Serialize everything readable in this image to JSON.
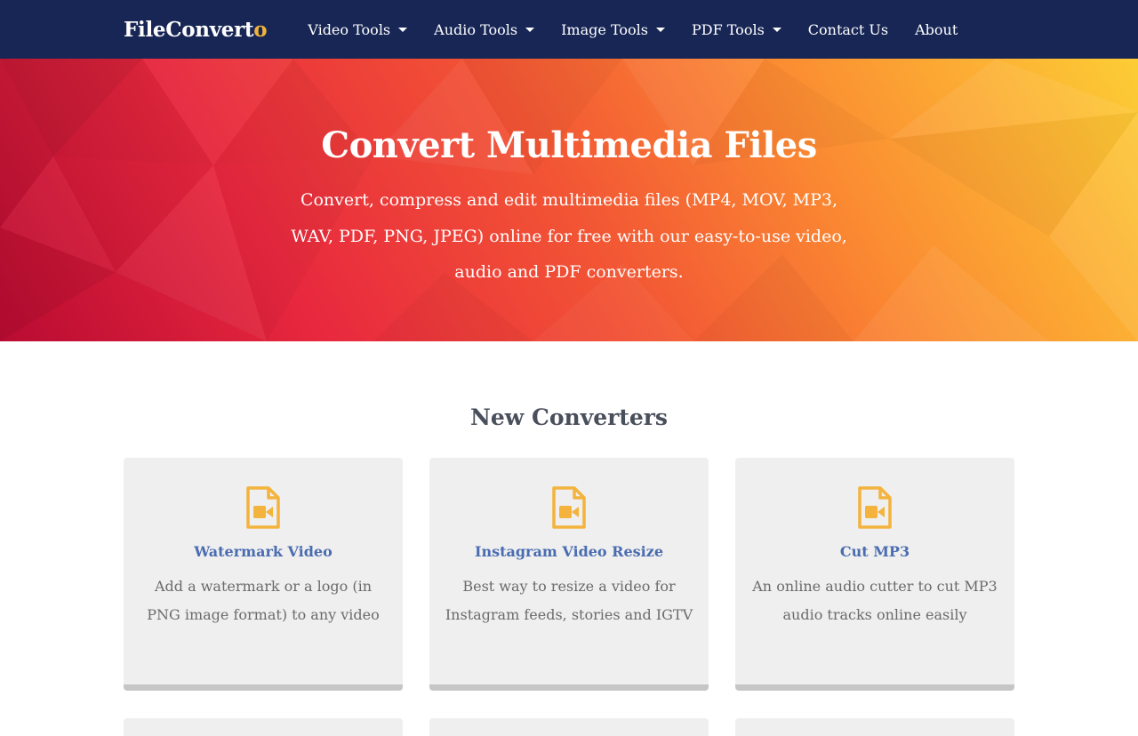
{
  "nav": {
    "brand_main": "FileConvert",
    "brand_accent": "o",
    "items": [
      {
        "label": "Video Tools",
        "dropdown": true
      },
      {
        "label": "Audio Tools",
        "dropdown": true
      },
      {
        "label": "Image Tools",
        "dropdown": true
      },
      {
        "label": "PDF Tools",
        "dropdown": true
      },
      {
        "label": "Contact Us",
        "dropdown": false
      },
      {
        "label": "About",
        "dropdown": false
      }
    ]
  },
  "hero": {
    "title": "Convert Multimedia Files",
    "subtitle": "Convert, compress and edit multimedia files (MP4, MOV, MP3, WAV, PDF, PNG, JPEG) online for free with our easy-to-use video, audio and PDF converters."
  },
  "section": {
    "title": "New Converters"
  },
  "cards": [
    {
      "icon": "video-file-icon",
      "title": "Watermark Video",
      "desc": "Add a watermark or a logo (in PNG image format) to any video"
    },
    {
      "icon": "video-file-icon",
      "title": "Instagram Video Resize",
      "desc": "Best way to resize a video for Instagram feeds, stories and IGTV"
    },
    {
      "icon": "video-file-icon",
      "title": "Cut MP3",
      "desc": "An online audio cutter to cut MP3 audio tracks online easily"
    }
  ],
  "colors": {
    "navbar_bg": "#172655",
    "brand_accent": "#f2b43a",
    "card_title": "#4a6cb0",
    "icon": "#f3b33d",
    "card_bg": "#efefef"
  }
}
